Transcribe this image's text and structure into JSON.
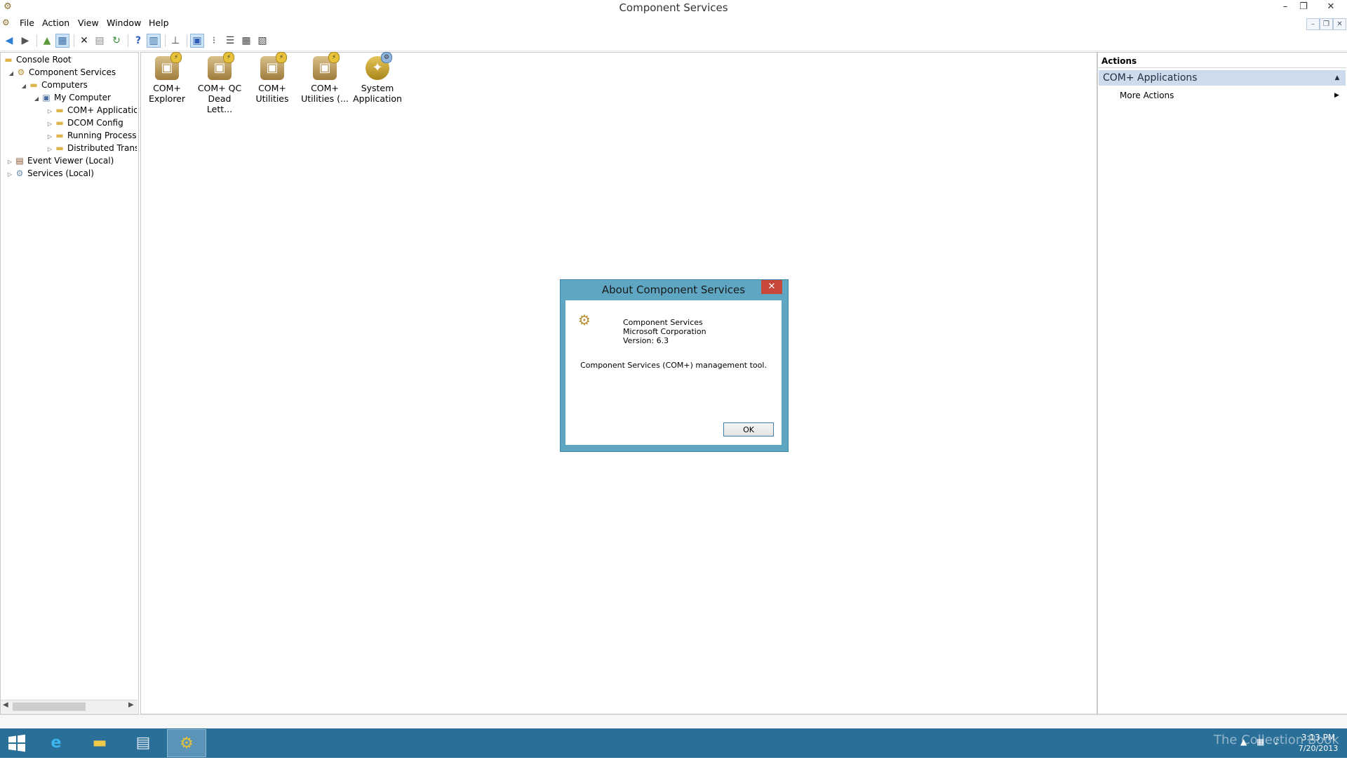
{
  "window": {
    "title": "Component Services",
    "minimize": "–",
    "restore": "❐",
    "close": "✕"
  },
  "menu": {
    "items": [
      "File",
      "Action",
      "View",
      "Window",
      "Help"
    ],
    "mdi_min": "–",
    "mdi_restore": "❐",
    "mdi_close": "✕"
  },
  "tree": {
    "items": [
      {
        "label": "Console Root",
        "level": 0,
        "icon": "folder-icon"
      },
      {
        "label": "Component Services",
        "level": 1,
        "icon": "component-services-icon"
      },
      {
        "label": "Computers",
        "level": 2,
        "icon": "folder-icon"
      },
      {
        "label": "My Computer",
        "level": 3,
        "icon": "computer-icon"
      },
      {
        "label": "COM+ Applicatio",
        "level": 4,
        "icon": "folder-icon"
      },
      {
        "label": "DCOM Config",
        "level": 4,
        "icon": "folder-icon"
      },
      {
        "label": "Running Processe",
        "level": 4,
        "icon": "folder-icon"
      },
      {
        "label": "Distributed Trans",
        "level": 4,
        "icon": "folder-icon"
      },
      {
        "label": "Event Viewer (Local)",
        "level": 0,
        "icon": "event-viewer-icon"
      },
      {
        "label": "Services (Local)",
        "level": 0,
        "icon": "services-icon"
      }
    ]
  },
  "content": {
    "icons": [
      {
        "line1": "COM+",
        "line2": "Explorer"
      },
      {
        "line1": "COM+ QC",
        "line2": "Dead Lett..."
      },
      {
        "line1": "COM+",
        "line2": "Utilities"
      },
      {
        "line1": "COM+",
        "line2": "Utilities (..."
      },
      {
        "line1": "System",
        "line2": "Application"
      }
    ]
  },
  "actions": {
    "header": "Actions",
    "section": "COM+ Applications",
    "more": "More Actions"
  },
  "dialog": {
    "title": "About Component Services",
    "product": "Component Services",
    "company": "Microsoft Corporation",
    "version": "Version: 6.3",
    "description": "Component Services (COM+) management tool.",
    "ok": "OK"
  },
  "taskbar": {
    "watermark": "The Collection Book",
    "time": "3:13 PM",
    "date": "7/20/2013"
  }
}
